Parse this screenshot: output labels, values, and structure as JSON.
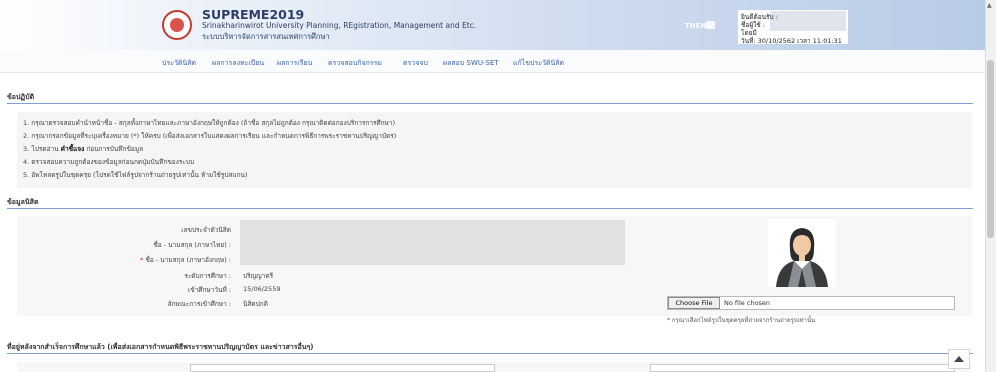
{
  "header": {
    "title": "SUPREME2019",
    "subtitle": "Srinakharinwirot University Planning, REgistration, Management and Etc.",
    "subtitle_th": "ระบบบริหารจัดการสารสนเทศการศึกษา",
    "lang": "THEN",
    "user": {
      "line1": "ยินดีต้อนรับ :",
      "line2": "ชื่อผู้ใช้ :",
      "line3": "โดยมี",
      "line4": "วันที่: 30/10/2562 เวลา 11:01:31"
    }
  },
  "nav": {
    "items": [
      "ประวัตินิสิต",
      "ผลการลงทะเบียน",
      "ผลการเรียน",
      "ตรวจสอบกิจกรรม",
      "ตรวจจบ",
      "ผลสอบ SWU-SET",
      "แก้ไขประวัตินิสิต"
    ]
  },
  "rules": {
    "title": "ข้อปฏิบัติ",
    "items": [
      "1. กรุณาตรวจสอบคำนำหน้าชื่อ - สกุลทั้งภาษาไทยและภาษาอังกฤษให้ถูกต้อง (ถ้าชื่อ สกุลไม่ถูกต้อง กรุณาติดต่อกองบริการการศึกษา)",
      "2. กรุณากรอกข้อมูลที่ระบุเครื่องหมาย (*) ให้ครบ (เพื่อส่งเอกสารใบแสดงผลการเรียน และกำหนดการพิธีการพระราชทานปริญญาบัตร)",
      "3. โปรดอ่าน ",
      "4. ตรวจสอบความถูกต้องของข้อมูลก่อนกดปุ่มบันทึกของระบบ",
      "5. อัพโหลดรูปในชุดครุย (โปรดใช้ไฟล์รูปจากร้านถ่ายรูปเท่านั้น ห้ามใช้รูปสแกน)"
    ],
    "item3_bold": "คำชี้แจง",
    "item3_tail": " ก่อนการบันทึกข้อมูล"
  },
  "student": {
    "section_title": "ข้อมูลนิสิต",
    "labels": {
      "student_id": "เลขประจำตัวนิสิต",
      "name_th": "ชื่อ - นามสกุล (ภาษาไทย) :",
      "name_en": "ชื่อ - นามสกุล (ภาษาอังกฤษ) :",
      "level": "ระดับการศึกษา :",
      "entry_date": "เข้าศึกษาวันที่ :",
      "entry_type": "ลักษณะการเข้าศึกษา :"
    },
    "values": {
      "level": "ปริญญาตรี",
      "entry_date": "15/06/2559",
      "entry_type": "นิสิตปกติ"
    },
    "req_mark": "*",
    "upload": {
      "button": "Choose File",
      "status": "No file chosen",
      "hint": "* กรุณาเลือกไฟล์รูปในชุดครุยที่ถ่ายจากร้านถ่ายรูปเท่านั้น"
    }
  },
  "address": {
    "section_title": "ที่อยู่หลังจากสำเร็จการศึกษาแล้ว (เพื่อส่งเอกสารกำหนดพิธีพระราชทานปริญญาบัตร และข่าวสารอื่นๆ)"
  },
  "colors": {
    "accent": "#3a64a8",
    "section_line": "#7ea1d2",
    "required": "#dd2222"
  }
}
